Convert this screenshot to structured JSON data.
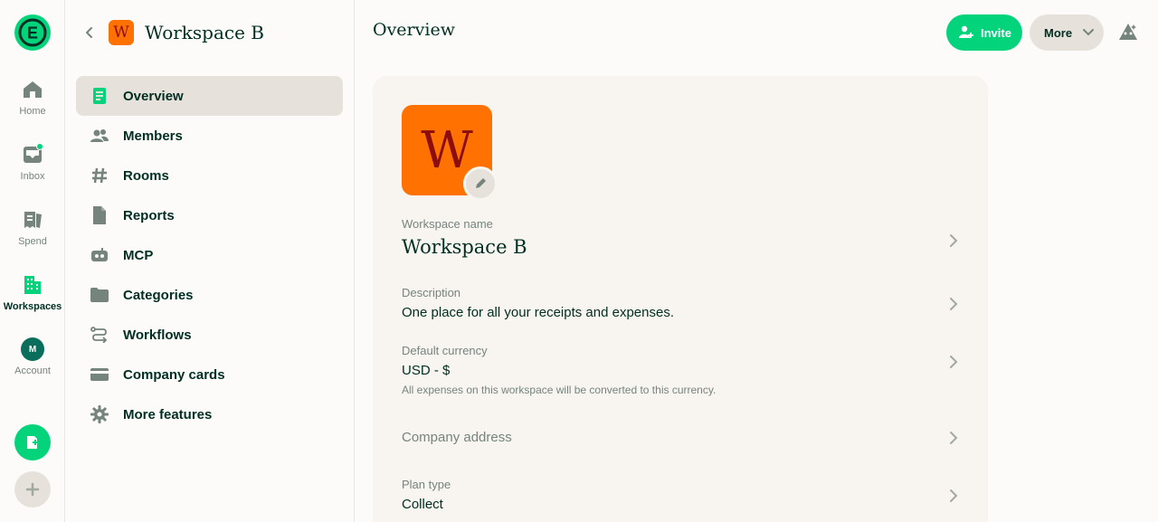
{
  "rail": {
    "items": [
      {
        "label": "Home",
        "icon": "home-icon"
      },
      {
        "label": "Inbox",
        "icon": "inbox-icon"
      },
      {
        "label": "Spend",
        "icon": "receipt-icon"
      },
      {
        "label": "Workspaces",
        "icon": "building-icon"
      },
      {
        "label": "Account",
        "icon": "avatar"
      }
    ],
    "account_initial": "M",
    "logo_letter": "E"
  },
  "sidebar": {
    "workspace_initial": "W",
    "workspace_title": "Workspace B",
    "items": [
      {
        "label": "Overview",
        "icon": "document-icon"
      },
      {
        "label": "Members",
        "icon": "users-icon"
      },
      {
        "label": "Rooms",
        "icon": "hashtag-icon"
      },
      {
        "label": "Reports",
        "icon": "file-icon"
      },
      {
        "label": "MCP",
        "icon": "robot-icon"
      },
      {
        "label": "Categories",
        "icon": "folder-icon"
      },
      {
        "label": "Workflows",
        "icon": "workflow-icon"
      },
      {
        "label": "Company cards",
        "icon": "credit-card-icon"
      },
      {
        "label": "More features",
        "icon": "gear-icon"
      }
    ]
  },
  "header": {
    "title": "Overview",
    "invite_label": "Invite",
    "more_label": "More"
  },
  "overview": {
    "avatar_letter": "W",
    "name_label": "Workspace name",
    "name_value": "Workspace B",
    "description_label": "Description",
    "description_value": "One place for all your receipts and expenses.",
    "currency_label": "Default currency",
    "currency_value": "USD - $",
    "currency_hint": "All expenses on this workspace will be converted to this currency.",
    "address_label": "Company address",
    "plan_label": "Plan type",
    "plan_value": "Collect"
  },
  "colors": {
    "accent": "#03d47c",
    "text": "#002e22",
    "muted": "#76847e",
    "workspace_avatar": "#ff7101",
    "workspace_letter": "#8b0d0d"
  }
}
